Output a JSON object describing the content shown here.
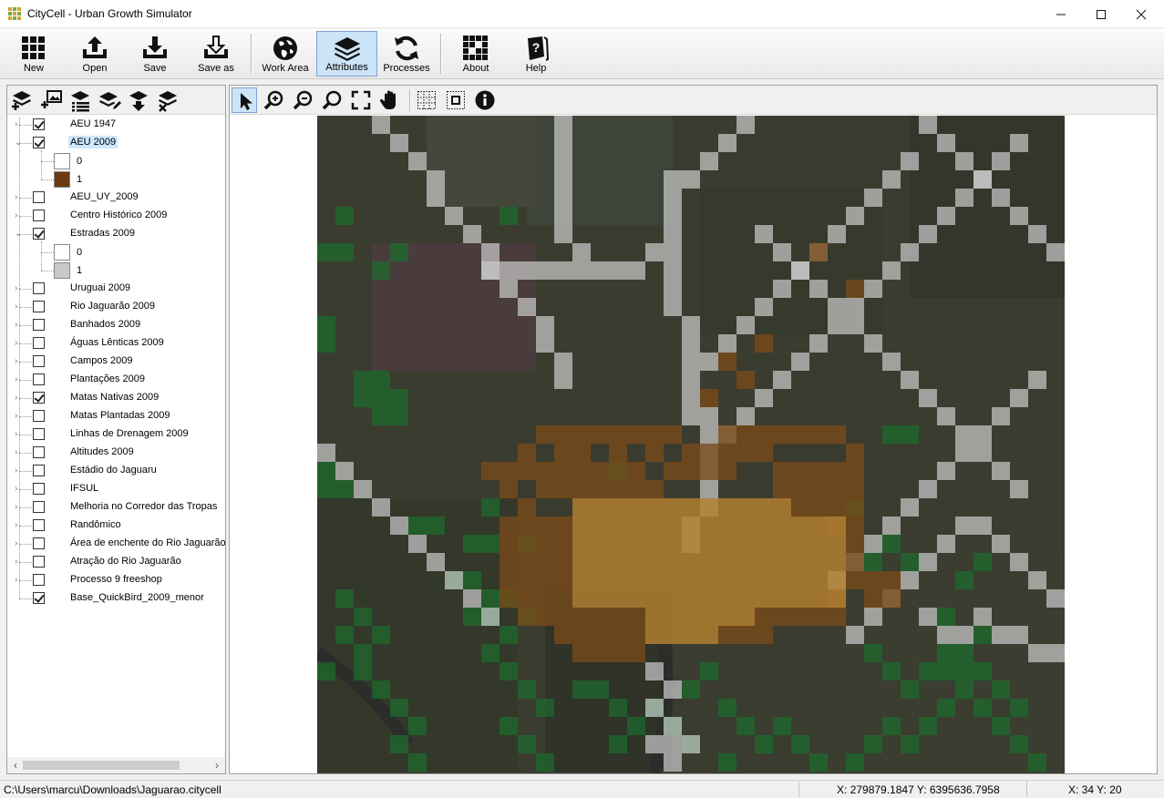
{
  "window": {
    "title": "CityCell - Urban Growth Simulator",
    "minimize_icon": "minimize-icon",
    "maximize_icon": "maximize-icon",
    "close_icon": "close-icon"
  },
  "toolbar": {
    "buttons": [
      {
        "label": "New",
        "icon": "grid-new-icon"
      },
      {
        "label": "Open",
        "icon": "upload-tray-icon"
      },
      {
        "label": "Save",
        "icon": "download-tray-icon"
      },
      {
        "label": "Save as",
        "icon": "download-tray-outline-icon"
      },
      {
        "label": "Work Area",
        "icon": "globe-icon"
      },
      {
        "label": "Attributes",
        "icon": "layers-icon",
        "active": true
      },
      {
        "label": "Processes",
        "icon": "refresh-icon"
      },
      {
        "label": "About",
        "icon": "grid-about-icon"
      },
      {
        "label": "Help",
        "icon": "help-book-icon"
      }
    ]
  },
  "layer_tools": [
    "add-layer-icon",
    "add-image-icon",
    "layer-list-icon",
    "layer-edit-icon",
    "layer-down-icon",
    "layer-remove-icon"
  ],
  "map_tools": [
    "pointer-icon",
    "zoom-in-icon",
    "zoom-out-icon",
    "zoom-icon",
    "fit-extent-icon",
    "pan-hand-icon",
    "grid-dotted-icon",
    "select-cell-icon",
    "info-icon"
  ],
  "layers": [
    {
      "name": "AEU 1947",
      "checked": true,
      "expanded": false
    },
    {
      "name": "AEU 2009",
      "checked": true,
      "expanded": true,
      "selected": true,
      "legend": [
        {
          "value": "0",
          "color": "#ffffff"
        },
        {
          "value": "1",
          "color": "#6b3a10"
        }
      ]
    },
    {
      "name": "AEU_UY_2009",
      "checked": false
    },
    {
      "name": "Centro Histórico 2009",
      "checked": false
    },
    {
      "name": "Estradas 2009",
      "checked": true,
      "expanded": true,
      "legend": [
        {
          "value": "0",
          "color": "#ffffff"
        },
        {
          "value": "1",
          "color": "#c8c8c8"
        }
      ]
    },
    {
      "name": "Uruguai 2009",
      "checked": false
    },
    {
      "name": "Rio Jaguarão 2009",
      "checked": false
    },
    {
      "name": "Banhados 2009",
      "checked": false
    },
    {
      "name": "Águas Lênticas 2009",
      "checked": false
    },
    {
      "name": "Campos 2009",
      "checked": false
    },
    {
      "name": "Plantações 2009",
      "checked": false
    },
    {
      "name": "Matas Nativas 2009",
      "checked": true
    },
    {
      "name": "Matas Plantadas 2009",
      "checked": false
    },
    {
      "name": "Linhas de Drenagem 2009",
      "checked": false
    },
    {
      "name": "Altitudes 2009",
      "checked": false
    },
    {
      "name": "Estádio do Jaguaru",
      "checked": false
    },
    {
      "name": "IFSUL",
      "checked": false
    },
    {
      "name": "Melhoria no Corredor das Tropas",
      "checked": false
    },
    {
      "name": "Randômico",
      "checked": false
    },
    {
      "name": "Área de enchente do Rio Jaguarão",
      "checked": false
    },
    {
      "name": "Atração do Rio Jaguarão",
      "checked": false
    },
    {
      "name": "Processo 9 freeshop",
      "checked": false
    },
    {
      "name": "Base_QuickBird_2009_menor",
      "checked": true
    }
  ],
  "status": {
    "path": "C:\\Users\\marcu\\Downloads\\Jaguarao.citycell",
    "coords": "X: 279879.1847   Y: 6395636.7958",
    "cell": "X: 34   Y: 20"
  },
  "colors": {
    "urban": "#b5802f",
    "urban_edge": "#7a4a18",
    "roads": "#c8c8c8",
    "forest": "#1e6a2c",
    "imagery": "#3b3c30"
  }
}
